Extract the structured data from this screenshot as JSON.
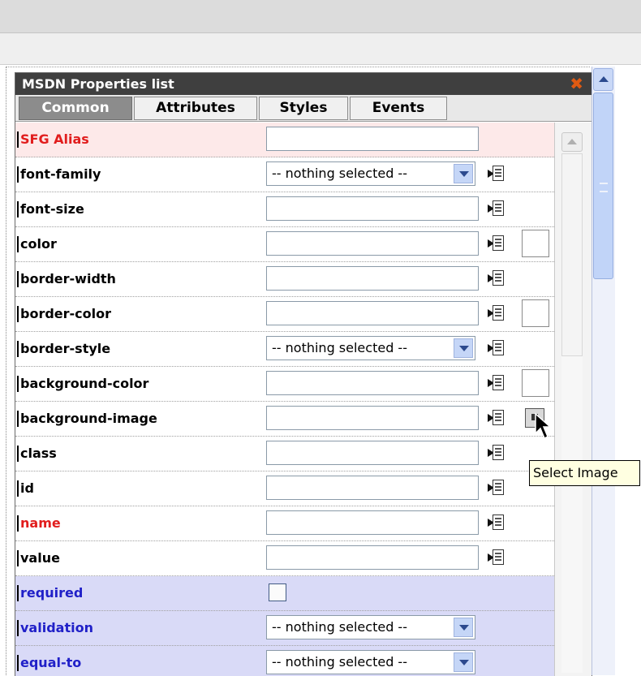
{
  "panel": {
    "title": "MSDN Properties list",
    "close_icon": "close-icon"
  },
  "tabs": [
    {
      "label": "Common",
      "active": true
    },
    {
      "label": "Attributes",
      "active": false
    },
    {
      "label": "Styles",
      "active": false
    },
    {
      "label": "Events",
      "active": false
    }
  ],
  "rows": [
    {
      "label": "SFG Alias",
      "control": "text",
      "value": "",
      "label_color": "red",
      "row_style": "alias",
      "insert_button": false,
      "swatch": false
    },
    {
      "label": "font-family",
      "control": "select",
      "value": "-- nothing selected --",
      "label_color": "black",
      "insert_button": true
    },
    {
      "label": "font-size",
      "control": "text",
      "value": "",
      "label_color": "black",
      "insert_button": true
    },
    {
      "label": "color",
      "control": "text",
      "value": "",
      "label_color": "black",
      "insert_button": true,
      "swatch": true
    },
    {
      "label": "border-width",
      "control": "text",
      "value": "",
      "label_color": "black",
      "insert_button": true
    },
    {
      "label": "border-color",
      "control": "text",
      "value": "",
      "label_color": "black",
      "insert_button": true,
      "swatch": true
    },
    {
      "label": "border-style",
      "control": "select",
      "value": "-- nothing selected --",
      "label_color": "black",
      "insert_button": true
    },
    {
      "label": "background-color",
      "control": "text",
      "value": "",
      "label_color": "black",
      "insert_button": true,
      "swatch": true
    },
    {
      "label": "background-image",
      "control": "text",
      "value": "",
      "label_color": "black",
      "insert_button": true,
      "image_button": true
    },
    {
      "label": "class",
      "control": "text",
      "value": "",
      "label_color": "black",
      "insert_button": true
    },
    {
      "label": "id",
      "control": "text",
      "value": "",
      "label_color": "black",
      "insert_button": true
    },
    {
      "label": "name",
      "control": "text",
      "value": "",
      "label_color": "red",
      "insert_button": true
    },
    {
      "label": "value",
      "control": "text",
      "value": "",
      "label_color": "black",
      "insert_button": true
    },
    {
      "label": "required",
      "control": "checkbox",
      "checked": false,
      "label_color": "blue",
      "row_style": "blue"
    },
    {
      "label": "validation",
      "control": "select",
      "value": "-- nothing selected --",
      "label_color": "blue",
      "row_style": "blue"
    },
    {
      "label": "equal-to",
      "control": "select",
      "value": "-- nothing selected --",
      "label_color": "blue",
      "row_style": "blue"
    }
  ],
  "tooltip": {
    "text": "Select Image"
  },
  "colors": {
    "titlebar": "#3f3f3f",
    "active_tab": "#8c8c8c",
    "alias_row": "#fde9e9",
    "validation_rows": "#d9daf7",
    "red_label": "#e11d1d",
    "blue_label": "#2020c8",
    "close_icon": "#e05a12"
  }
}
